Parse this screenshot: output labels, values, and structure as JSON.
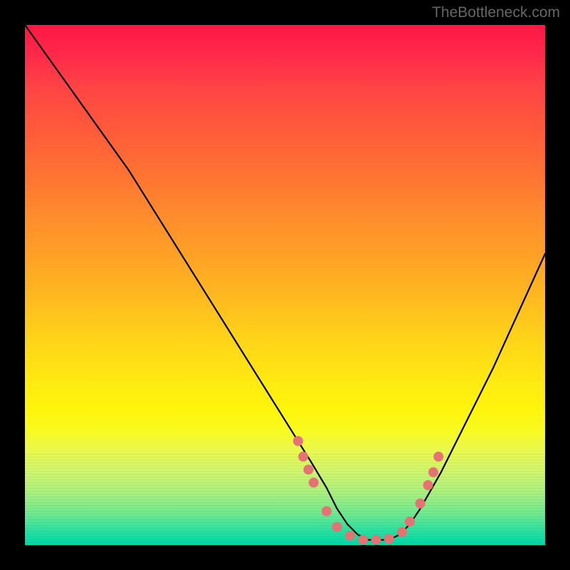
{
  "watermark": "TheBottleneck.com",
  "chart_data": {
    "type": "line",
    "title": "",
    "xlabel": "",
    "ylabel": "",
    "xlim": [
      0,
      100
    ],
    "ylim": [
      0,
      100
    ],
    "series": [
      {
        "name": "curve",
        "x": [
          0,
          5,
          10,
          15,
          20,
          25,
          30,
          35,
          40,
          45,
          50,
          55,
          58,
          60,
          62,
          64,
          66,
          68,
          70,
          72,
          74,
          76,
          80,
          85,
          90,
          95,
          100
        ],
        "y": [
          100,
          93,
          86,
          79,
          72,
          64,
          56,
          48,
          40,
          32,
          24,
          16,
          11,
          7,
          4,
          2,
          1,
          1,
          1,
          2,
          4,
          7,
          14,
          24,
          34,
          45,
          56
        ]
      }
    ],
    "markers": {
      "name": "dots",
      "color": "#e57373",
      "x": [
        52.5,
        53.5,
        54.5,
        55.5,
        58.0,
        60.0,
        62.5,
        65.0,
        67.5,
        70.0,
        72.5,
        74.0,
        76.0,
        77.5,
        78.5,
        79.5
      ],
      "y": [
        20.0,
        17.0,
        14.5,
        12.0,
        6.5,
        3.5,
        1.8,
        1.0,
        1.0,
        1.2,
        2.5,
        4.5,
        8.0,
        11.5,
        14.0,
        17.0
      ]
    },
    "gradient_colors": {
      "top": "#ff1744",
      "mid": "#ffe812",
      "bottom": "#00d8a8"
    }
  }
}
